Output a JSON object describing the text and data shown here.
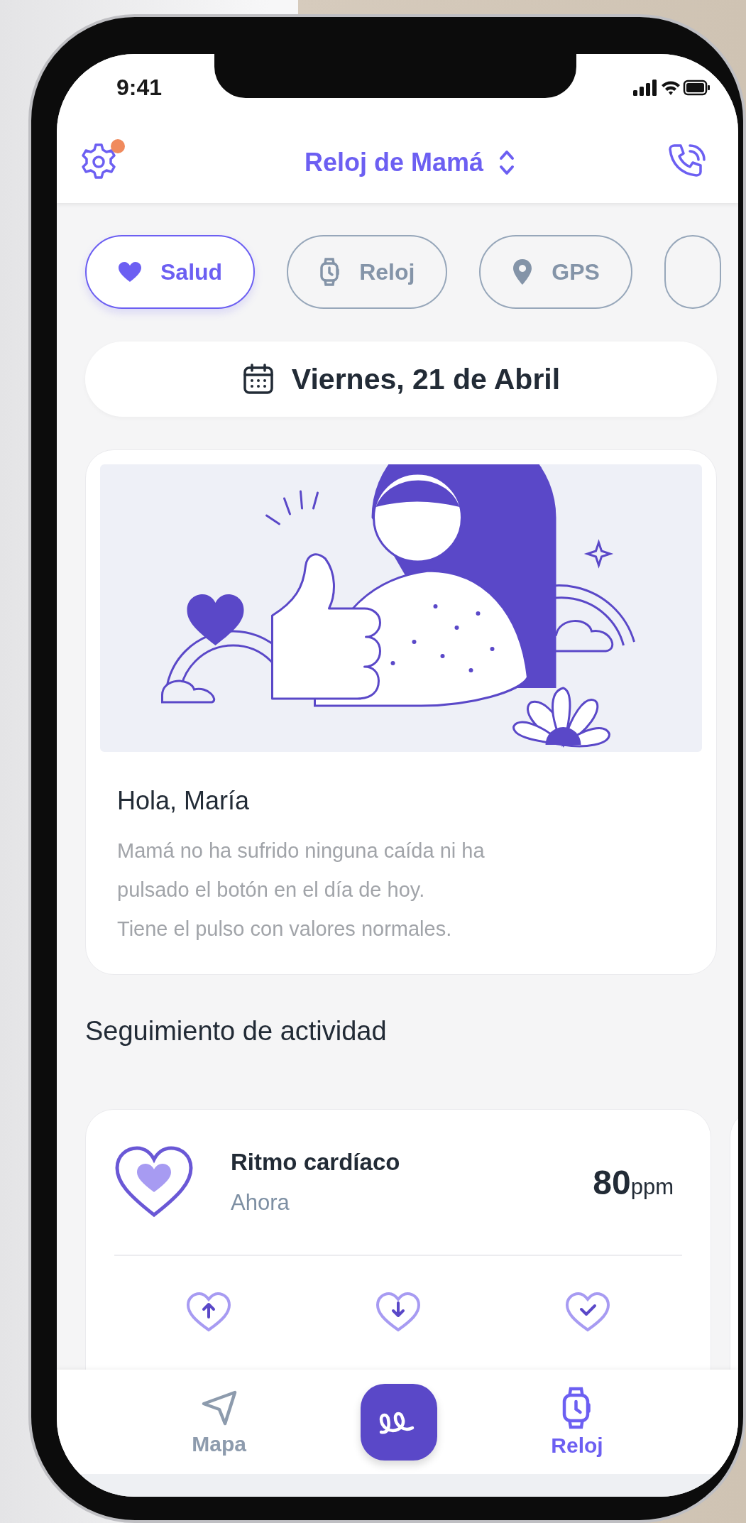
{
  "status_bar": {
    "time": "9:41"
  },
  "header": {
    "title": "Reloj de Mamá",
    "notification": true
  },
  "tabs": [
    {
      "label": "Salud",
      "selected": true
    },
    {
      "label": "Reloj",
      "selected": false
    },
    {
      "label": "GPS",
      "selected": false
    }
  ],
  "date": "Viernes, 21 de Abril",
  "greeting": {
    "title": "Hola, María",
    "lines": [
      "Mamá no ha sufrido ninguna caída ni ha",
      "pulsado el botón en el día de hoy.",
      "Tiene el pulso con valores normales."
    ]
  },
  "activity": {
    "title": "Seguimiento de actividad",
    "cards": [
      {
        "title": "Ritmo cardíaco",
        "subtitle": "Ahora",
        "value": "80",
        "unit": "ppm",
        "stats": [
          {
            "kind": "up"
          },
          {
            "kind": "down"
          },
          {
            "kind": "check"
          }
        ]
      }
    ]
  },
  "nav": [
    {
      "kind": "tab",
      "label": "Mapa",
      "selected": false
    },
    {
      "kind": "center",
      "selected": false
    },
    {
      "kind": "tab",
      "label": "Reloj",
      "selected": true
    }
  ]
}
